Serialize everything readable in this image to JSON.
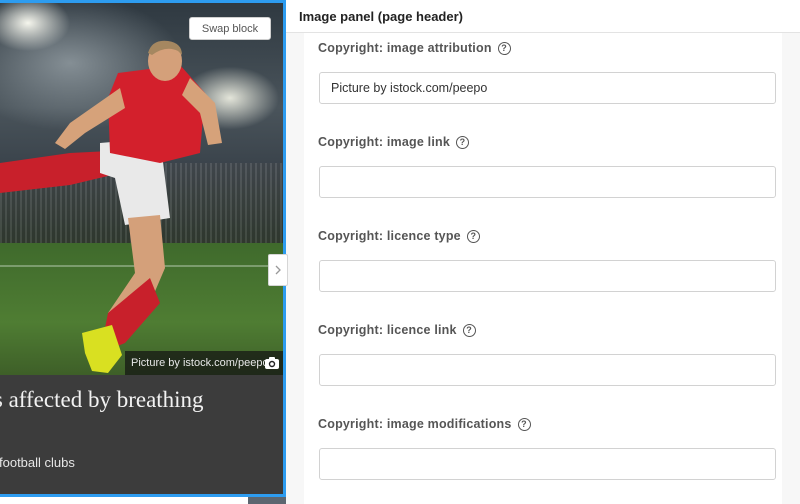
{
  "preview": {
    "swap_button_label": "Swap block",
    "image_credit": "Picture by istock.com/peepo.",
    "camera_icon": "camera-icon",
    "headline": "ers affected by breathing",
    "subline": "football clubs",
    "expand_icon": "chevron-right-icon",
    "accent_color": "#2d9cf0"
  },
  "panel": {
    "title": "Image panel (page header)",
    "help_icon_glyph": "?",
    "fields": [
      {
        "label": "Copyright: image attribution",
        "value": "Picture by istock.com/peepo",
        "placeholder": ""
      },
      {
        "label": "Copyright: image link",
        "value": "",
        "placeholder": ""
      },
      {
        "label": "Copyright: licence type",
        "value": "",
        "placeholder": ""
      },
      {
        "label": "Copyright: licence link",
        "value": "",
        "placeholder": ""
      },
      {
        "label": "Copyright: image modifications",
        "value": "",
        "placeholder": ""
      }
    ]
  }
}
